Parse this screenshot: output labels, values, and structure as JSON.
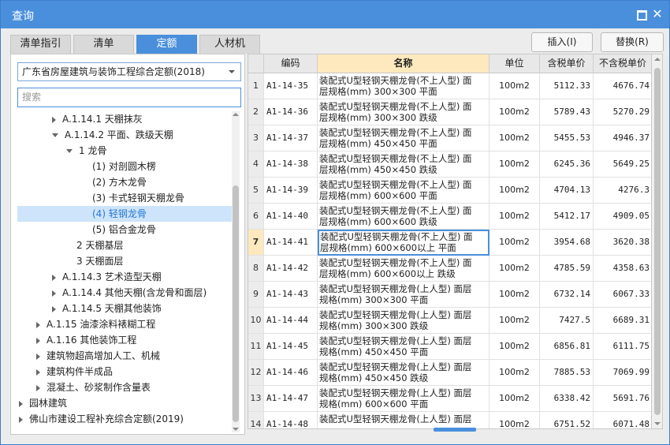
{
  "window": {
    "title": "查询"
  },
  "tabs": [
    {
      "label": "清单指引"
    },
    {
      "label": "清单"
    },
    {
      "label": "定额"
    },
    {
      "label": "人材机"
    }
  ],
  "actions": {
    "insert_label": "插入(I)",
    "replace_label": "替换(R)"
  },
  "left": {
    "library": "广东省房屋建筑与装饰工程综合定额(2018)",
    "search_placeholder": "搜索",
    "tree": [
      {
        "label": "A.1.14.1 天棚抹灰",
        "toggle": "r",
        "indent": 3
      },
      {
        "label": "A.1.14.2 平面、跌级天棚",
        "toggle": "d",
        "indent": 3
      },
      {
        "label": "1 龙骨",
        "toggle": "d",
        "indent": 4
      },
      {
        "label": "(1) 对剖圆木楞",
        "toggle": "",
        "indent": 5
      },
      {
        "label": "(2) 方木龙骨",
        "toggle": "",
        "indent": 5
      },
      {
        "label": "(3) 卡式轻钢天棚龙骨",
        "toggle": "",
        "indent": 5
      },
      {
        "label": "(4) 轻钢龙骨",
        "toggle": "",
        "indent": 5,
        "selected": true
      },
      {
        "label": "(5) 铝合金龙骨",
        "toggle": "",
        "indent": 5
      },
      {
        "label": "2 天棚基层",
        "toggle": "",
        "indent": 4
      },
      {
        "label": "3 天棚面层",
        "toggle": "",
        "indent": 4
      },
      {
        "label": "A.1.14.3 艺术造型天棚",
        "toggle": "r",
        "indent": 3
      },
      {
        "label": "A.1.14.4 其他天棚(含龙骨和面层)",
        "toggle": "r",
        "indent": 3
      },
      {
        "label": "A.1.14.5 天棚其他装饰",
        "toggle": "r",
        "indent": 3
      },
      {
        "label": "A.1.15 油漆涂料裱糊工程",
        "toggle": "r",
        "indent": 2
      },
      {
        "label": "A.1.16 其他装饰工程",
        "toggle": "r",
        "indent": 2
      },
      {
        "label": "建筑物超高增加人工、机械",
        "toggle": "r",
        "indent": 2
      },
      {
        "label": "建筑构件半成品",
        "toggle": "r",
        "indent": 2
      },
      {
        "label": "混凝土、砂浆制作含量表",
        "toggle": "r",
        "indent": 2
      },
      {
        "label": "园林建筑",
        "toggle": "r",
        "indent": 1
      },
      {
        "label": "佛山市建设工程补充综合定额(2019)",
        "toggle": "r",
        "indent": 1
      }
    ]
  },
  "grid": {
    "headers": [
      "",
      "编码",
      "名称",
      "单位",
      "含税单价",
      "不含税单价"
    ],
    "current_row": 7,
    "rows": [
      {
        "idx": "1",
        "code": "A1-14-35",
        "name1": "装配式U型轻钢天棚龙骨(不上人型) 面",
        "name2": "层规格(mm) 300×300 平面",
        "unit": "100m2",
        "tax": "5112.33",
        "notax": "4676.74"
      },
      {
        "idx": "2",
        "code": "A1-14-36",
        "name1": "装配式U型轻钢天棚龙骨(不上人型) 面",
        "name2": "层规格(mm) 300×300 跌级",
        "unit": "100m2",
        "tax": "5789.43",
        "notax": "5270.29"
      },
      {
        "idx": "3",
        "code": "A1-14-37",
        "name1": "装配式U型轻钢天棚龙骨(不上人型) 面",
        "name2": "层规格(mm) 450×450 平面",
        "unit": "100m2",
        "tax": "5455.53",
        "notax": "4946.37"
      },
      {
        "idx": "4",
        "code": "A1-14-38",
        "name1": "装配式U型轻钢天棚龙骨(不上人型) 面",
        "name2": "层规格(mm) 450×450 跌级",
        "unit": "100m2",
        "tax": "6245.36",
        "notax": "5649.25"
      },
      {
        "idx": "5",
        "code": "A1-14-39",
        "name1": "装配式U型轻钢天棚龙骨(不上人型) 面",
        "name2": "层规格(mm) 600×600 平面",
        "unit": "100m2",
        "tax": "4704.13",
        "notax": "4276.3"
      },
      {
        "idx": "6",
        "code": "A1-14-40",
        "name1": "装配式U型轻钢天棚龙骨(不上人型) 面",
        "name2": "层规格(mm) 600×600 跌级",
        "unit": "100m2",
        "tax": "5412.17",
        "notax": "4909.05"
      },
      {
        "idx": "7",
        "code": "A1-14-41",
        "name1": "装配式U型轻钢天棚龙骨(不上人型) 面",
        "name2": "层规格(mm) 600×600以上 平面",
        "unit": "100m2",
        "tax": "3954.68",
        "notax": "3620.38"
      },
      {
        "idx": "8",
        "code": "A1-14-42",
        "name1": "装配式U型轻钢天棚龙骨(不上人型) 面",
        "name2": "层规格(mm) 600×600以上 跌级",
        "unit": "100m2",
        "tax": "4785.59",
        "notax": "4358.63"
      },
      {
        "idx": "9",
        "code": "A1-14-43",
        "name1": "装配式U型轻钢天棚龙骨(上人型) 面层",
        "name2": "规格(mm) 300×300 平面",
        "unit": "100m2",
        "tax": "6732.14",
        "notax": "6067.33"
      },
      {
        "idx": "10",
        "code": "A1-14-44",
        "name1": "装配式U型轻钢天棚龙骨(上人型) 面层",
        "name2": "规格(mm) 300×300 跌级",
        "unit": "100m2",
        "tax": "7427.5",
        "notax": "6689.31"
      },
      {
        "idx": "11",
        "code": "A1-14-45",
        "name1": "装配式U型轻钢天棚龙骨(上人型) 面层",
        "name2": "规格(mm) 450×450 平面",
        "unit": "100m2",
        "tax": "6856.81",
        "notax": "6111.75"
      },
      {
        "idx": "12",
        "code": "A1-14-46",
        "name1": "装配式U型轻钢天棚龙骨(上人型) 面层",
        "name2": "规格(mm) 450×450 跌级",
        "unit": "100m2",
        "tax": "7885.53",
        "notax": "7069.99"
      },
      {
        "idx": "13",
        "code": "A1-14-47",
        "name1": "装配式U型轻钢天棚龙骨(上人型) 面层",
        "name2": "规格(mm) 600×600 平面",
        "unit": "100m2",
        "tax": "6338.42",
        "notax": "5691.76"
      },
      {
        "idx": "14",
        "code": "A1-14-48",
        "name1": "装配式U型轻钢天棚龙骨(上人型) 面层",
        "name2": "",
        "unit": "100m2",
        "tax": "6751.52",
        "notax": "6071.48"
      }
    ]
  }
}
